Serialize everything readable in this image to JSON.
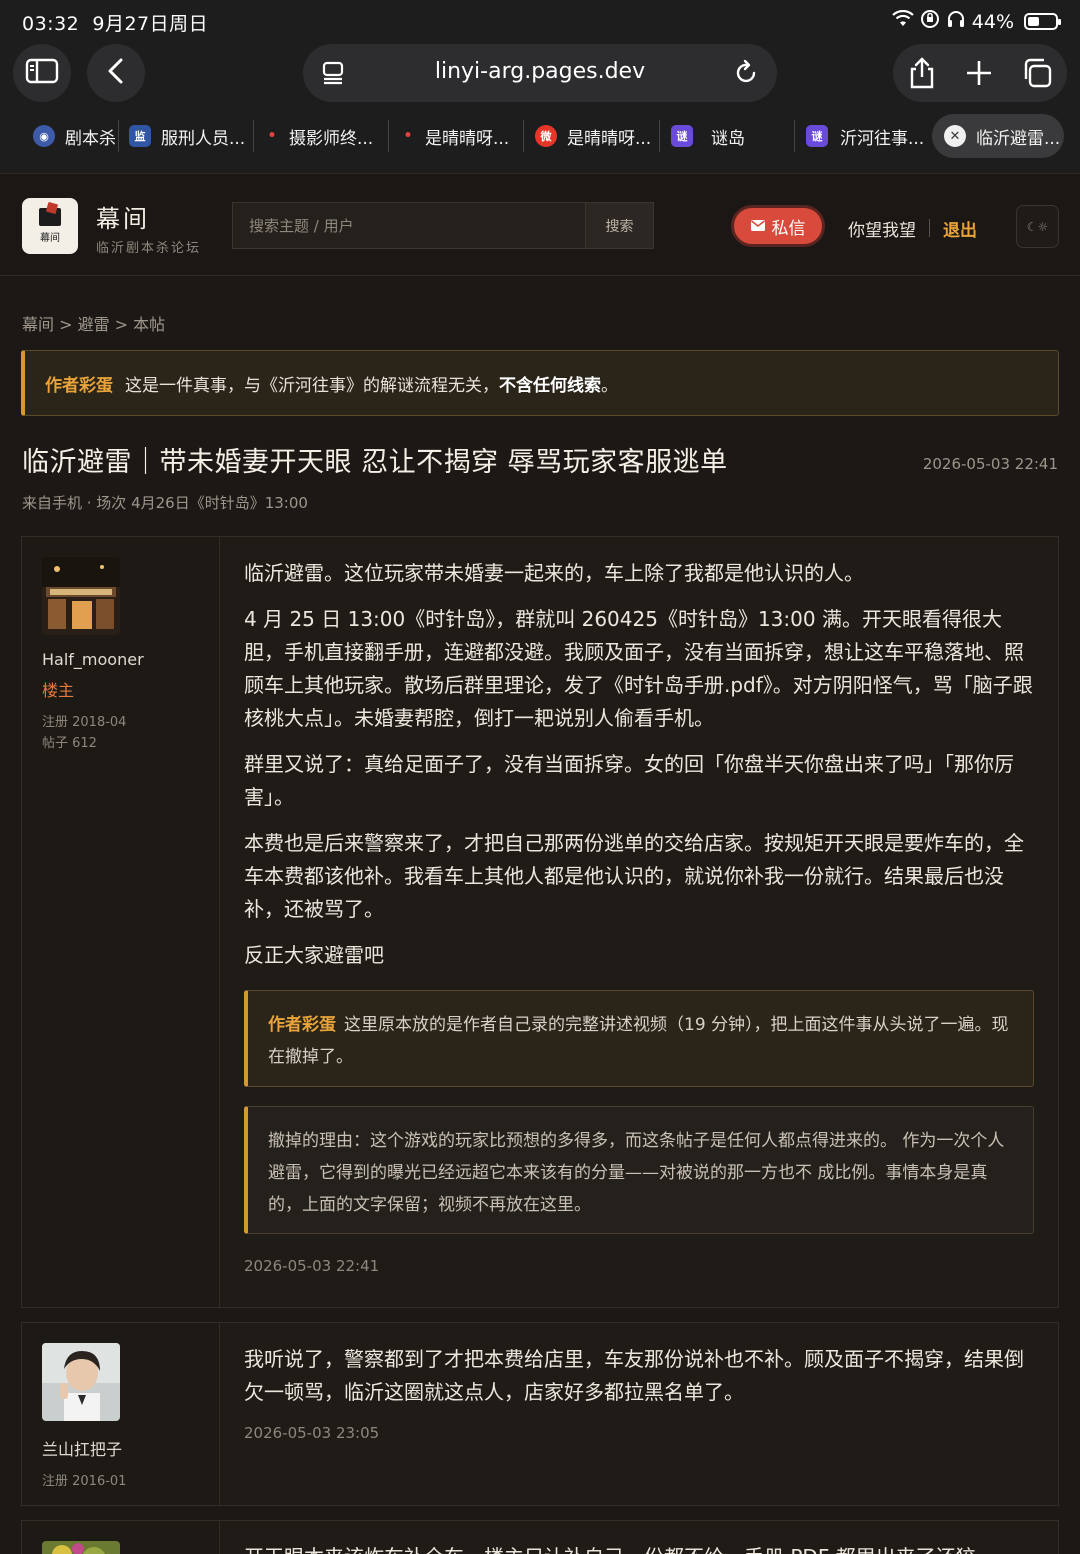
{
  "status": {
    "time": "03:32",
    "date": "9月27日周日",
    "battery": "44%",
    "battery_level": 0.44
  },
  "browser": {
    "url": "linyi-arg.pages.dev",
    "tabs": [
      {
        "label": "剧本杀",
        "icon": "globe-icon"
      },
      {
        "label": "服刑人员...",
        "icon": "document-icon"
      },
      {
        "label": "摄影师终...",
        "icon": "pin-icon"
      },
      {
        "label": "是晴晴呀...",
        "icon": "pin-icon"
      },
      {
        "label": "是晴晴呀...",
        "icon": "weibo-icon"
      },
      {
        "label": "谜岛",
        "icon": "puzzle-icon"
      },
      {
        "label": "沂河往事...",
        "icon": "puzzle-icon"
      },
      {
        "label": "临沂避雷...",
        "icon": "close-icon"
      }
    ]
  },
  "site": {
    "name": "幕间",
    "subtitle": "临沂剧本杀论坛",
    "logo_text": "幕间",
    "search_placeholder": "搜索主题 / 用户",
    "search_button": "搜索",
    "pm_button": "私信",
    "username": "你望我望",
    "logout": "退出",
    "theme_toggle": "☾☼"
  },
  "breadcrumb": "幕间 > 避雷 > 本帖",
  "notice": {
    "tag": "作者彩蛋",
    "text": "这是一件真事，与《沂河往事》的解谜流程无关，",
    "bold": "不含任何线索",
    "end": "。"
  },
  "post": {
    "title": "临沂避雷｜带未婚妻开天眼 忍让不揭穿 辱骂玩家客服逃单",
    "date": "2026-05-03 22:41",
    "meta": "来自手机 · 场次 4月26日《时针岛》13:00"
  },
  "replies": [
    {
      "author": "Half_mooner",
      "role": "楼主",
      "registered": "注册 2018-04",
      "posts": "帖子 612",
      "paragraphs": [
        "临沂避雷。这位玩家带未婚妻一起来的，车上除了我都是他认识的人。",
        "4 月 25 日 13:00《时针岛》，群就叫 260425《时针岛》13:00 满。开天眼看得很大胆，手机直接翻手册，连避都没避。我顾及面子，没有当面拆穿，想让这车平稳落地、照顾车上其他玩家。散场后群里理论，发了《时针岛手册.pdf》。对方阴阳怪气，骂「脑子跟核桃大点」。未婚妻帮腔，倒打一耙说别人偷看手机。",
        "群里又说了：真给足面子了，没有当面拆穿。女的回「你盘半天你盘出来了吗」「那你厉害」。",
        "本费也是后来警察来了，才把自己那两份逃单的交给店家。按规矩开天眼是要炸车的，全车本费都该他补。我看车上其他人都是他认识的，就说你补我一份就行。结果最后也没补，还被骂了。",
        "反正大家避雷吧"
      ],
      "quote1_tag": "作者彩蛋",
      "quote1_text": "这里原本放的是作者自己录的完整讲述视频（19 分钟），把上面这件事从头说了一遍。现在撤掉了。",
      "quote2_text": "撤掉的理由：这个游戏的玩家比预想的多得多，而这条帖子是任何人都点得进来的。 作为一次个人避雷，它得到的曝光已经远超它本来该有的分量——对被说的那一方也不 成比例。事情本身是真的，上面的文字保留；视频不再放在这里。",
      "timestamp": "2026-05-03 22:41"
    },
    {
      "author": "兰山扛把子",
      "registered": "注册 2016-01",
      "paragraphs": [
        "我听说了，警察都到了才把本费给店里，车友那份说补也不补。顾及面子不揭穿，结果倒欠一顿骂，临沂这圈就这点人，店家好多都拉黑名单了。"
      ],
      "timestamp": "2026-05-03 23:05"
    },
    {
      "paragraphs": [
        "开天眼本来该炸车补全车，楼主只让补自己一份都不给，手册 PDF 都甩出来了还狡"
      ]
    }
  ]
}
